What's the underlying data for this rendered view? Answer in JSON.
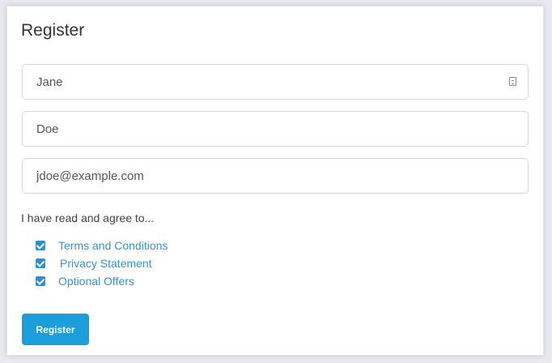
{
  "form": {
    "title": "Register",
    "first_name": {
      "value": "Jane"
    },
    "last_name": {
      "value": "Doe"
    },
    "email": {
      "value": "jdoe@example.com"
    },
    "agree_text": "I have read and agree to...",
    "agreements": [
      {
        "label": "Terms and Conditions",
        "checked": true
      },
      {
        "label": "Privacy Statement",
        "checked": true
      },
      {
        "label": "Optional Offers",
        "checked": true
      }
    ],
    "submit_label": "Register"
  },
  "colors": {
    "accent": "#1b9fdc",
    "link": "#3a8fd0",
    "checkbox": "#2b8fd6"
  },
  "icons": {
    "autofill": "contact-card-icon"
  }
}
